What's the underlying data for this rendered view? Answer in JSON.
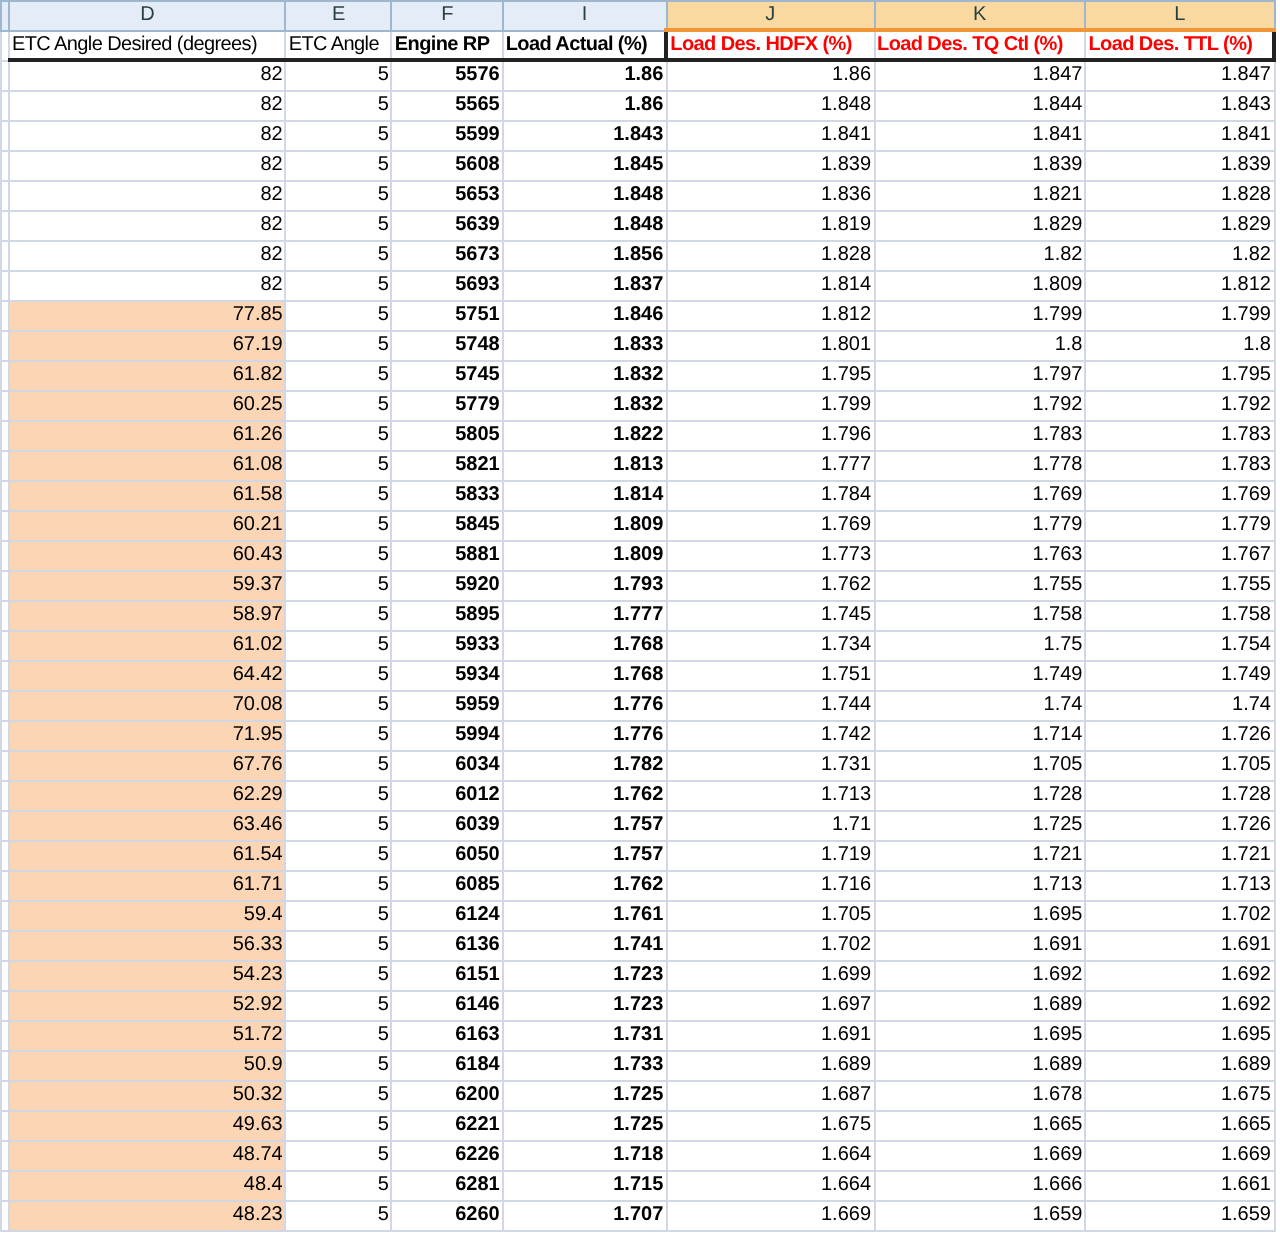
{
  "columns": [
    {
      "letter": "D",
      "title": "ETC Angle Desired (degrees)",
      "selected": false,
      "title_bold": false,
      "values_bold": false,
      "color": "#000000"
    },
    {
      "letter": "E",
      "title": "ETC Angle",
      "selected": false,
      "title_bold": false,
      "values_bold": false,
      "color": "#000000"
    },
    {
      "letter": "F",
      "title": "Engine RP",
      "selected": false,
      "title_bold": true,
      "values_bold": true,
      "color": "#000000"
    },
    {
      "letter": "I",
      "title": "Load Actual (%)",
      "selected": false,
      "title_bold": true,
      "values_bold": true,
      "color": "#000000"
    },
    {
      "letter": "J",
      "title": "Load Des. HDFX (%)",
      "selected": true,
      "title_bold": true,
      "values_bold": false,
      "color": "#ff0000"
    },
    {
      "letter": "K",
      "title": "Load Des. TQ Ctl (%)",
      "selected": true,
      "title_bold": true,
      "values_bold": false,
      "color": "#ff0000"
    },
    {
      "letter": "L",
      "title": "Load Des. TTL (%)",
      "selected": true,
      "title_bold": true,
      "values_bold": false,
      "color": "#ff0000"
    }
  ],
  "rows": [
    {
      "shaded": false,
      "cells": [
        "82",
        "5",
        "5576",
        "1.86",
        "1.86",
        "1.847",
        "1.847"
      ]
    },
    {
      "shaded": false,
      "cells": [
        "82",
        "5",
        "5565",
        "1.86",
        "1.848",
        "1.844",
        "1.843"
      ]
    },
    {
      "shaded": false,
      "cells": [
        "82",
        "5",
        "5599",
        "1.843",
        "1.841",
        "1.841",
        "1.841"
      ]
    },
    {
      "shaded": false,
      "cells": [
        "82",
        "5",
        "5608",
        "1.845",
        "1.839",
        "1.839",
        "1.839"
      ]
    },
    {
      "shaded": false,
      "cells": [
        "82",
        "5",
        "5653",
        "1.848",
        "1.836",
        "1.821",
        "1.828"
      ]
    },
    {
      "shaded": false,
      "cells": [
        "82",
        "5",
        "5639",
        "1.848",
        "1.819",
        "1.829",
        "1.829"
      ]
    },
    {
      "shaded": false,
      "cells": [
        "82",
        "5",
        "5673",
        "1.856",
        "1.828",
        "1.82",
        "1.82"
      ]
    },
    {
      "shaded": false,
      "cells": [
        "82",
        "5",
        "5693",
        "1.837",
        "1.814",
        "1.809",
        "1.812"
      ]
    },
    {
      "shaded": true,
      "cells": [
        "77.85",
        "5",
        "5751",
        "1.846",
        "1.812",
        "1.799",
        "1.799"
      ]
    },
    {
      "shaded": true,
      "cells": [
        "67.19",
        "5",
        "5748",
        "1.833",
        "1.801",
        "1.8",
        "1.8"
      ]
    },
    {
      "shaded": true,
      "cells": [
        "61.82",
        "5",
        "5745",
        "1.832",
        "1.795",
        "1.797",
        "1.795"
      ]
    },
    {
      "shaded": true,
      "cells": [
        "60.25",
        "5",
        "5779",
        "1.832",
        "1.799",
        "1.792",
        "1.792"
      ]
    },
    {
      "shaded": true,
      "cells": [
        "61.26",
        "5",
        "5805",
        "1.822",
        "1.796",
        "1.783",
        "1.783"
      ]
    },
    {
      "shaded": true,
      "cells": [
        "61.08",
        "5",
        "5821",
        "1.813",
        "1.777",
        "1.778",
        "1.783"
      ]
    },
    {
      "shaded": true,
      "cells": [
        "61.58",
        "5",
        "5833",
        "1.814",
        "1.784",
        "1.769",
        "1.769"
      ]
    },
    {
      "shaded": true,
      "cells": [
        "60.21",
        "5",
        "5845",
        "1.809",
        "1.769",
        "1.779",
        "1.779"
      ]
    },
    {
      "shaded": true,
      "cells": [
        "60.43",
        "5",
        "5881",
        "1.809",
        "1.773",
        "1.763",
        "1.767"
      ]
    },
    {
      "shaded": true,
      "cells": [
        "59.37",
        "5",
        "5920",
        "1.793",
        "1.762",
        "1.755",
        "1.755"
      ]
    },
    {
      "shaded": true,
      "cells": [
        "58.97",
        "5",
        "5895",
        "1.777",
        "1.745",
        "1.758",
        "1.758"
      ]
    },
    {
      "shaded": true,
      "cells": [
        "61.02",
        "5",
        "5933",
        "1.768",
        "1.734",
        "1.75",
        "1.754"
      ]
    },
    {
      "shaded": true,
      "cells": [
        "64.42",
        "5",
        "5934",
        "1.768",
        "1.751",
        "1.749",
        "1.749"
      ]
    },
    {
      "shaded": true,
      "cells": [
        "70.08",
        "5",
        "5959",
        "1.776",
        "1.744",
        "1.74",
        "1.74"
      ]
    },
    {
      "shaded": true,
      "cells": [
        "71.95",
        "5",
        "5994",
        "1.776",
        "1.742",
        "1.714",
        "1.726"
      ]
    },
    {
      "shaded": true,
      "cells": [
        "67.76",
        "5",
        "6034",
        "1.782",
        "1.731",
        "1.705",
        "1.705"
      ]
    },
    {
      "shaded": true,
      "cells": [
        "62.29",
        "5",
        "6012",
        "1.762",
        "1.713",
        "1.728",
        "1.728"
      ]
    },
    {
      "shaded": true,
      "cells": [
        "63.46",
        "5",
        "6039",
        "1.757",
        "1.71",
        "1.725",
        "1.726"
      ]
    },
    {
      "shaded": true,
      "cells": [
        "61.54",
        "5",
        "6050",
        "1.757",
        "1.719",
        "1.721",
        "1.721"
      ]
    },
    {
      "shaded": true,
      "cells": [
        "61.71",
        "5",
        "6085",
        "1.762",
        "1.716",
        "1.713",
        "1.713"
      ]
    },
    {
      "shaded": true,
      "cells": [
        "59.4",
        "5",
        "6124",
        "1.761",
        "1.705",
        "1.695",
        "1.702"
      ]
    },
    {
      "shaded": true,
      "cells": [
        "56.33",
        "5",
        "6136",
        "1.741",
        "1.702",
        "1.691",
        "1.691"
      ]
    },
    {
      "shaded": true,
      "cells": [
        "54.23",
        "5",
        "6151",
        "1.723",
        "1.699",
        "1.692",
        "1.692"
      ]
    },
    {
      "shaded": true,
      "cells": [
        "52.92",
        "5",
        "6146",
        "1.723",
        "1.697",
        "1.689",
        "1.692"
      ]
    },
    {
      "shaded": true,
      "cells": [
        "51.72",
        "5",
        "6163",
        "1.731",
        "1.691",
        "1.695",
        "1.695"
      ]
    },
    {
      "shaded": true,
      "cells": [
        "50.9",
        "5",
        "6184",
        "1.733",
        "1.689",
        "1.689",
        "1.689"
      ]
    },
    {
      "shaded": true,
      "cells": [
        "50.32",
        "5",
        "6200",
        "1.725",
        "1.687",
        "1.678",
        "1.675"
      ]
    },
    {
      "shaded": true,
      "cells": [
        "49.63",
        "5",
        "6221",
        "1.725",
        "1.675",
        "1.665",
        "1.665"
      ]
    },
    {
      "shaded": true,
      "cells": [
        "48.74",
        "5",
        "6226",
        "1.718",
        "1.664",
        "1.669",
        "1.669"
      ]
    },
    {
      "shaded": true,
      "cells": [
        "48.4",
        "5",
        "6281",
        "1.715",
        "1.664",
        "1.666",
        "1.661"
      ]
    },
    {
      "shaded": true,
      "cells": [
        "48.23",
        "5",
        "6260",
        "1.707",
        "1.669",
        "1.659",
        "1.659"
      ]
    }
  ]
}
